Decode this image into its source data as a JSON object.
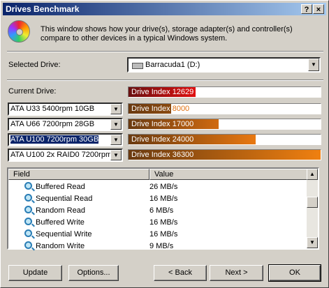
{
  "window": {
    "title": "Drives Benchmark",
    "help_label": "?",
    "close_label": "×"
  },
  "intro": "This window shows how your drive(s), storage adapter(s) and controller(s) compare to other devices in a typical Windows system.",
  "selected_drive": {
    "label": "Selected Drive:",
    "value": "Barracuda1 (D:)"
  },
  "current_drive": {
    "label": "Current Drive:",
    "bar_text": "Drive Index 12629",
    "index": 12629,
    "color": "#e01010"
  },
  "comparisons": [
    {
      "drive": "ATA U33 5400rpm 10GB",
      "bar_label": "Drive Index",
      "bar_value": "8000",
      "index": 8000,
      "color": "#8a4a10"
    },
    {
      "drive": "ATA U66 7200rpm 28GB",
      "bar_label": "Drive Index",
      "bar_value": "17000",
      "index": 17000,
      "color": "#d06a10"
    },
    {
      "drive": "ATA U100 7200rpm 30GB",
      "bar_label": "Drive Index",
      "bar_value": "24000",
      "index": 24000,
      "color": "#e87810",
      "selected": true
    },
    {
      "drive": "ATA U100 2x RAID0 7200rpm",
      "bar_label": "Drive Index",
      "bar_value": "36300",
      "index": 36300,
      "color": "#f08010"
    }
  ],
  "index_max": 36300,
  "table": {
    "headers": [
      "Field",
      "Value"
    ],
    "rows": [
      {
        "field": "Buffered Read",
        "value": "26 MB/s"
      },
      {
        "field": "Sequential Read",
        "value": "16 MB/s"
      },
      {
        "field": "Random Read",
        "value": "6 MB/s"
      },
      {
        "field": "Buffered Write",
        "value": "16 MB/s"
      },
      {
        "field": "Sequential Write",
        "value": "16 MB/s"
      },
      {
        "field": "Random Write",
        "value": "9 MB/s"
      }
    ],
    "icon": "magnifier-icon",
    "scroll_position": 0.37
  },
  "buttons": {
    "update": "Update",
    "options": "Options...",
    "back": "< Back",
    "next": "Next >",
    "ok": "OK"
  }
}
